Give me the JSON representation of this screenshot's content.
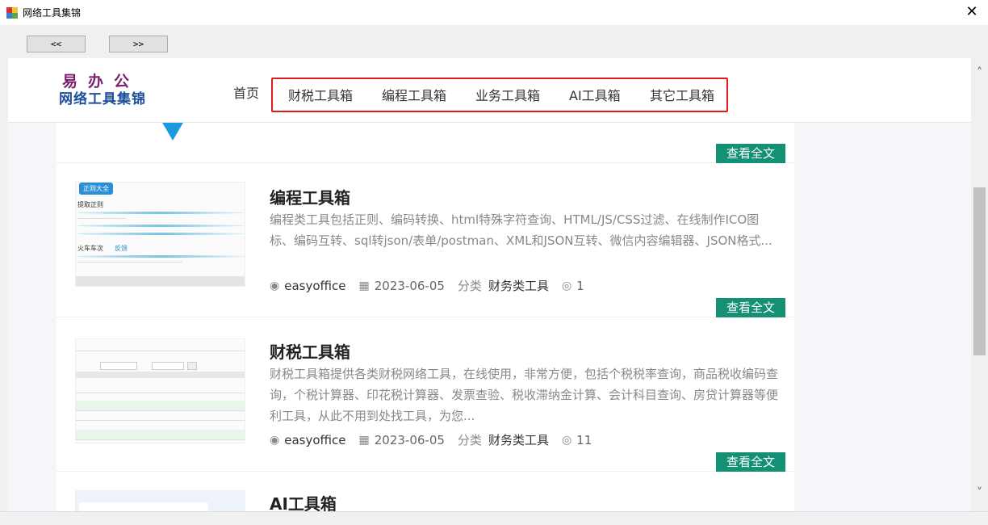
{
  "window": {
    "title": "网络工具集锦",
    "close_glyph": "✕"
  },
  "toolbar": {
    "back_label": "<<",
    "forward_label": ">>"
  },
  "site": {
    "logo_top": "易办公",
    "logo_bottom": "网络工具集锦",
    "nav_home": "首页",
    "nav_items": [
      {
        "label": "财税工具箱"
      },
      {
        "label": "编程工具箱"
      },
      {
        "label": "业务工具箱"
      },
      {
        "label": "AI工具箱"
      },
      {
        "label": "其它工具箱"
      }
    ],
    "highlight_color": "#e0191a",
    "accent_color": "#149174"
  },
  "articles": [
    {
      "read_more": "查看全文"
    },
    {
      "title": "编程工具箱",
      "desc": "编程类工具包括正则、编码转换、html特殊字符查询、HTML/JS/CSS过滤、在线制作ICO图标、编码互转、sql转json/表单/postman、XML和JSON互转、微信内容编辑器、JSON格式...",
      "author": "easyoffice",
      "date": "2023-06-05",
      "category_label": "分类",
      "category": "财务类工具",
      "views": "1",
      "read_more": "查看全文",
      "thumb": {
        "tag": "正则大全",
        "line1": "提取正则",
        "line2": "火车车次",
        "link": "反馈"
      }
    },
    {
      "title": "财税工具箱",
      "desc": "财税工具箱提供各类财税网络工具，在线使用，非常方便，包括个税税率查询，商品税收编码查询，个税计算器、印花税计算器、发票查验、税收滞纳金计算、会计科目查询、房贷计算器等便利工具，从此不用到处找工具，为您...",
      "author": "easyoffice",
      "date": "2023-06-05",
      "category_label": "分类",
      "category": "财务类工具",
      "views": "11",
      "read_more": "查看全文"
    },
    {
      "title": "AI工具箱"
    }
  ],
  "icons": {
    "author": "user-circle-icon",
    "date": "calendar-icon",
    "views": "eye-icon"
  }
}
